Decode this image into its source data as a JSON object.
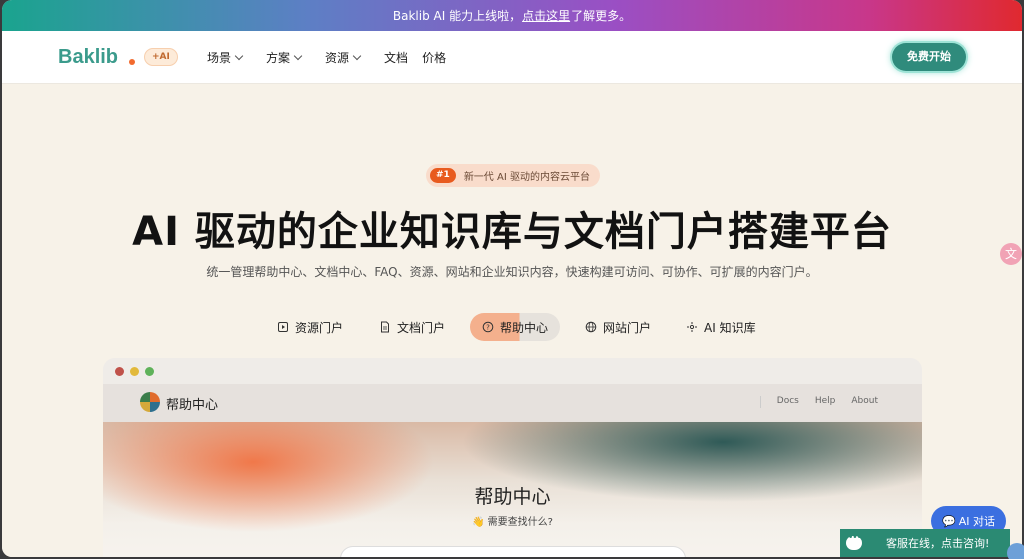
{
  "banner": {
    "prefix": "Baklib AI 能力上线啦，",
    "link": "点击这里",
    "suffix": "了解更多。"
  },
  "nav": {
    "logo": "Baklib",
    "ai_badge": "+AI",
    "items": [
      {
        "label": "场景",
        "dropdown": true
      },
      {
        "label": "方案",
        "dropdown": true
      },
      {
        "label": "资源",
        "dropdown": true
      },
      {
        "label": "文档",
        "dropdown": false
      },
      {
        "label": "价格",
        "dropdown": false
      }
    ],
    "cta": "免费开始"
  },
  "hero": {
    "pill_num": "#1",
    "pill_text": "新一代 AI 驱动的内容云平台",
    "title": "AI 驱动的企业知识库与文档门户搭建平台",
    "subtitle": "统一管理帮助中心、文档中心、FAQ、资源、网站和企业知识内容，快速构建可访问、可协作、可扩展的内容门户。",
    "tabs": [
      {
        "label": "资源门户",
        "icon": "resource-icon"
      },
      {
        "label": "文档门户",
        "icon": "document-icon"
      },
      {
        "label": "帮助中心",
        "icon": "help-icon",
        "active": true
      },
      {
        "label": "网站门户",
        "icon": "globe-icon"
      },
      {
        "label": "AI 知识库",
        "icon": "sparkle-icon"
      }
    ]
  },
  "preview": {
    "title": "帮助中心",
    "links": [
      "Docs",
      "Help",
      "About"
    ],
    "hero_title": "帮助中心",
    "hero_question": "👋 需要查找什么?"
  },
  "widgets": {
    "ai_chat": "AI 对话",
    "customer_service": "客服在线，点击咨询!"
  },
  "colors": {
    "accent": "#2f8b7c",
    "orange": "#e85b1f",
    "blue": "#3b6fe0"
  }
}
